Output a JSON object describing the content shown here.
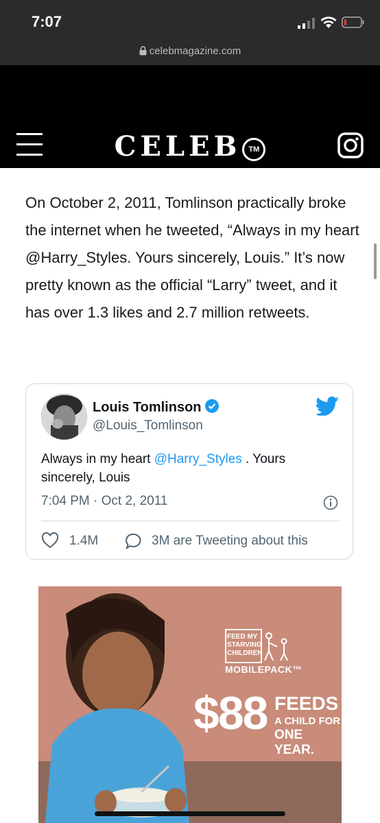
{
  "status": {
    "time": "7:07",
    "url": "celebmagazine.com"
  },
  "header": {
    "logo": "CELEB",
    "trademark": "TM"
  },
  "article": {
    "paragraph": "On October 2, 2011, Tomlinson practically broke the internet when he tweeted, “Always in my heart @Harry_Styles. Yours sincerely, Louis.” It’s now pretty known as the official “Larry” tweet, and it has over 1.3 likes and 2.7 million retweets."
  },
  "tweet": {
    "name": "Louis Tomlinson",
    "handle": "@Louis_Tomlinson",
    "text_before": "Always in my heart ",
    "mention": "@Harry_Styles",
    "text_after": " . Yours sincerely, Louis",
    "timestamp": "7:04 PM · Oct 2, 2011",
    "likes": "1.4M",
    "replies": "3M are Tweeting about this",
    "colors": {
      "link": "#1d9bf0",
      "verified": "#1d9bf0"
    }
  },
  "ad": {
    "brand_lines": [
      "FEED MY",
      "STARVING",
      "CHILDREN"
    ],
    "product": "MOBILEPACK™",
    "price": "$88",
    "feeds": "FEEDS",
    "line1": "A CHILD FOR",
    "line2": "ONE YEAR."
  }
}
